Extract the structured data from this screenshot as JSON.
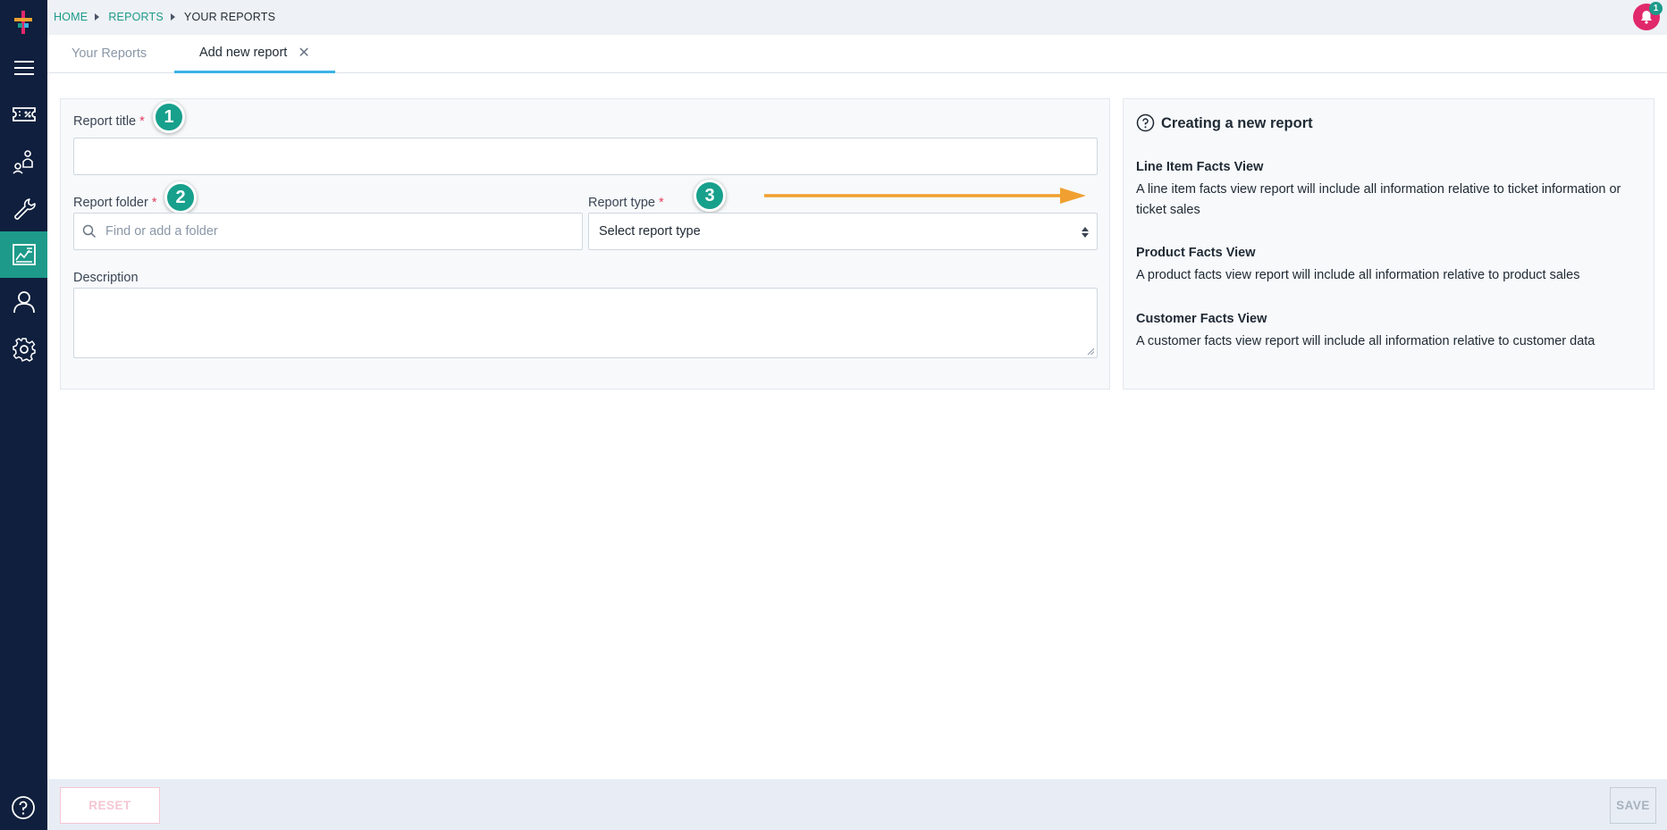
{
  "breadcrumb": {
    "items": [
      "HOME",
      "REPORTS",
      "YOUR REPORTS"
    ]
  },
  "notifications": {
    "count": "1"
  },
  "tabs": [
    {
      "label": "Your Reports"
    },
    {
      "label": "Add new report"
    }
  ],
  "form": {
    "title_label": "Report title",
    "folder_label": "Report folder",
    "folder_placeholder": "Find or add a folder",
    "type_label": "Report type",
    "type_value": "Select report type",
    "description_label": "Description",
    "required_mark": "*"
  },
  "steps": [
    "1",
    "2",
    "3"
  ],
  "info": {
    "title": "Creating a new report",
    "blocks": [
      {
        "heading": "Line Item Facts View",
        "text": "A line item facts view report will include all information relative to ticket information or ticket sales"
      },
      {
        "heading": "Product Facts View",
        "text": "A product facts view report will include all information relative to product sales"
      },
      {
        "heading": "Customer Facts View",
        "text": "A customer facts view report will include all information relative to customer data"
      }
    ]
  },
  "footer": {
    "reset_label": "RESET",
    "save_label": "SAVE"
  },
  "colors": {
    "sidebar": "#0f1f3d",
    "accent": "#1d9a8a",
    "tab_underline": "#3bb3e6",
    "notification": "#e0286b",
    "annotation_arrow": "#f0a030"
  },
  "sidebar_icons": [
    "logo-icon",
    "menu-icon",
    "ticket-icon",
    "network-icon",
    "wrench-icon",
    "reports-icon",
    "user-icon",
    "gear-icon",
    "help-icon"
  ]
}
